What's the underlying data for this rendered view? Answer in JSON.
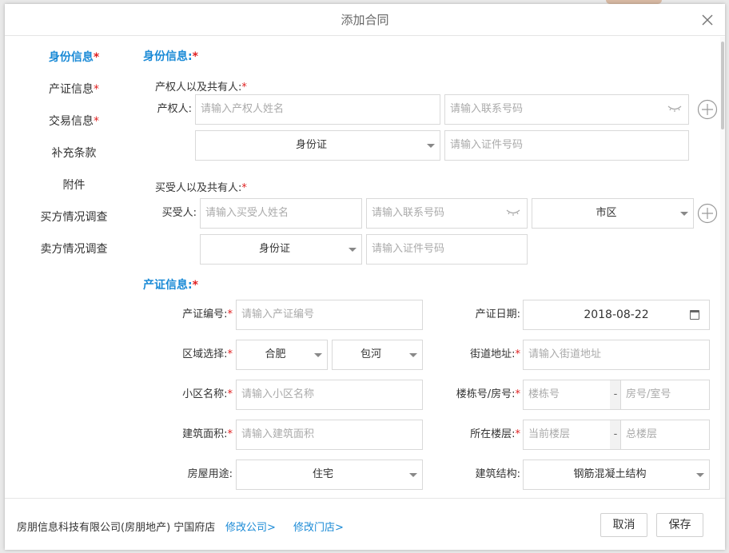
{
  "dialog": {
    "title": "添加合同"
  },
  "sidebar": {
    "items": [
      {
        "label": "身份信息",
        "required": "*"
      },
      {
        "label": "产证信息",
        "required": "*"
      },
      {
        "label": "交易信息",
        "required": "*"
      },
      {
        "label": "补充条款",
        "required": ""
      },
      {
        "label": "附件",
        "required": ""
      },
      {
        "label": "买方情况调查",
        "required": ""
      },
      {
        "label": "卖方情况调查",
        "required": ""
      }
    ]
  },
  "identity": {
    "title": "身份信息:",
    "owner_group": "产权人以及共有人:",
    "owner_label": "产权人:",
    "owner_name_placeholder": "请输入产权人姓名",
    "owner_phone_placeholder": "请输入联系号码",
    "owner_id_type": "身份证",
    "owner_id_placeholder": "请输入证件号码",
    "buyer_group": "买受人以及共有人:",
    "buyer_label": "买受人:",
    "buyer_name_placeholder": "请输入买受人姓名",
    "buyer_phone_placeholder": "请输入联系号码",
    "buyer_area": "市区",
    "buyer_id_type": "身份证",
    "buyer_id_placeholder": "请输入证件号码"
  },
  "property": {
    "title": "产证信息:",
    "cert_no_label": "产证编号:",
    "cert_no_placeholder": "请输入产证编号",
    "cert_date_label": "产证日期:",
    "cert_date_value": "2018-08-22",
    "region_label": "区域选择:",
    "region_city": "合肥",
    "region_district": "包河",
    "street_label": "街道地址:",
    "street_placeholder": "请输入街道地址",
    "community_label": "小区名称:",
    "community_placeholder": "请输入小区名称",
    "building_label": "楼栋号/房号:",
    "building_placeholder": "楼栋号",
    "room_placeholder": "房号/室号",
    "area_label": "建筑面积:",
    "area_placeholder": "请输入建筑面积",
    "floor_label": "所在楼层:",
    "floor_placeholder": "当前楼层",
    "total_floor_placeholder": "总楼层",
    "usage_label": "房屋用途:",
    "usage_value": "住宅",
    "structure_label": "建筑结构:",
    "structure_value": "钢筋混凝土结构",
    "dash": "-",
    "required": "*"
  },
  "footer": {
    "company": "房朋信息科技有限公司(房朋地产) 宁国府店",
    "change_company": "修改公司>",
    "change_store": "修改门店>",
    "cancel": "取消",
    "save": "保存"
  }
}
